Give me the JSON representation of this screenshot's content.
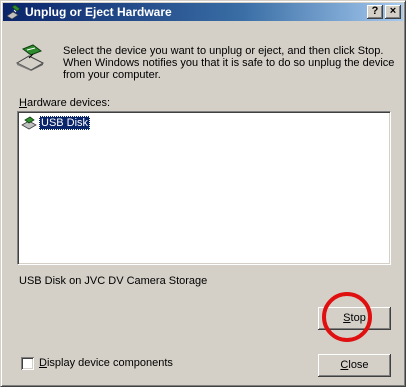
{
  "window": {
    "title": "Unplug or Eject Hardware",
    "help_button": "?",
    "close_button": "×"
  },
  "instructions": "Select the device you want to unplug or eject, and then click Stop. When Windows notifies you that it is safe to do so unplug the device from your computer.",
  "hardware_devices": {
    "label_underlined": "H",
    "label_rest": "ardware devices:",
    "items": [
      {
        "label": "USB Disk",
        "icon": "usb-disk-icon",
        "selected": true
      }
    ]
  },
  "device_description": "USB Disk on JVC DV Camera Storage",
  "buttons": {
    "stop_underlined": "S",
    "stop_rest": "top",
    "close_underlined": "C",
    "close_rest": "lose"
  },
  "display_components": {
    "checked": false,
    "label_underlined": "D",
    "label_rest": "isplay device components"
  },
  "colors": {
    "titlebar_start": "#0a246a",
    "titlebar_end": "#a6caf0",
    "selection": "#0a246a",
    "annotation_circle": "#e01010"
  }
}
